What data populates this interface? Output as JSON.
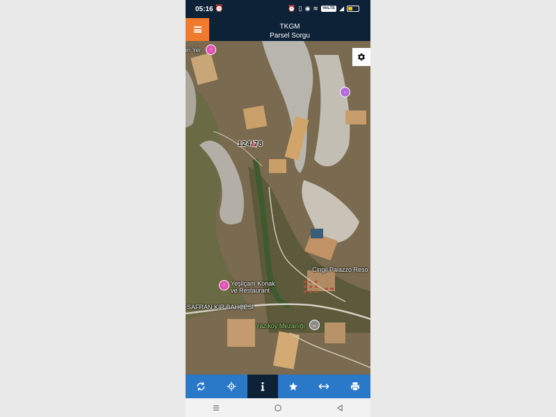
{
  "status": {
    "time": "05:16",
    "network_badge": "VoLTE",
    "battery_level": 0.45
  },
  "app": {
    "title": "TKGM",
    "subtitle": "Parsel Sorgu"
  },
  "map": {
    "parcel_number": "124/78",
    "pois": [
      {
        "name": "in Yer",
        "icon": "food-icon"
      },
      {
        "name": "",
        "icon": "place-of-worship-icon"
      },
      {
        "name": "Yeşilçam Konak ve Restaurant",
        "line1": "Yeşilçam Konak",
        "line2": "ve Restaurant",
        "icon": "food-icon"
      },
      {
        "name": "Yazıköy Mezarlığı",
        "icon": "cemetery-icon"
      }
    ],
    "labels": {
      "cingil": "Cingil Palazzo Reso",
      "safran": "SAFRAN KIR BAHÇESİ"
    }
  },
  "toolbar": {
    "items": [
      {
        "icon": "refresh-icon",
        "active": false
      },
      {
        "icon": "locate-icon",
        "active": false
      },
      {
        "icon": "info-icon",
        "active": true
      },
      {
        "icon": "star-icon",
        "active": false
      },
      {
        "icon": "measure-icon",
        "active": false
      },
      {
        "icon": "print-icon",
        "active": false
      }
    ]
  },
  "navigation": [
    "menu-icon",
    "home-icon",
    "back-icon"
  ]
}
